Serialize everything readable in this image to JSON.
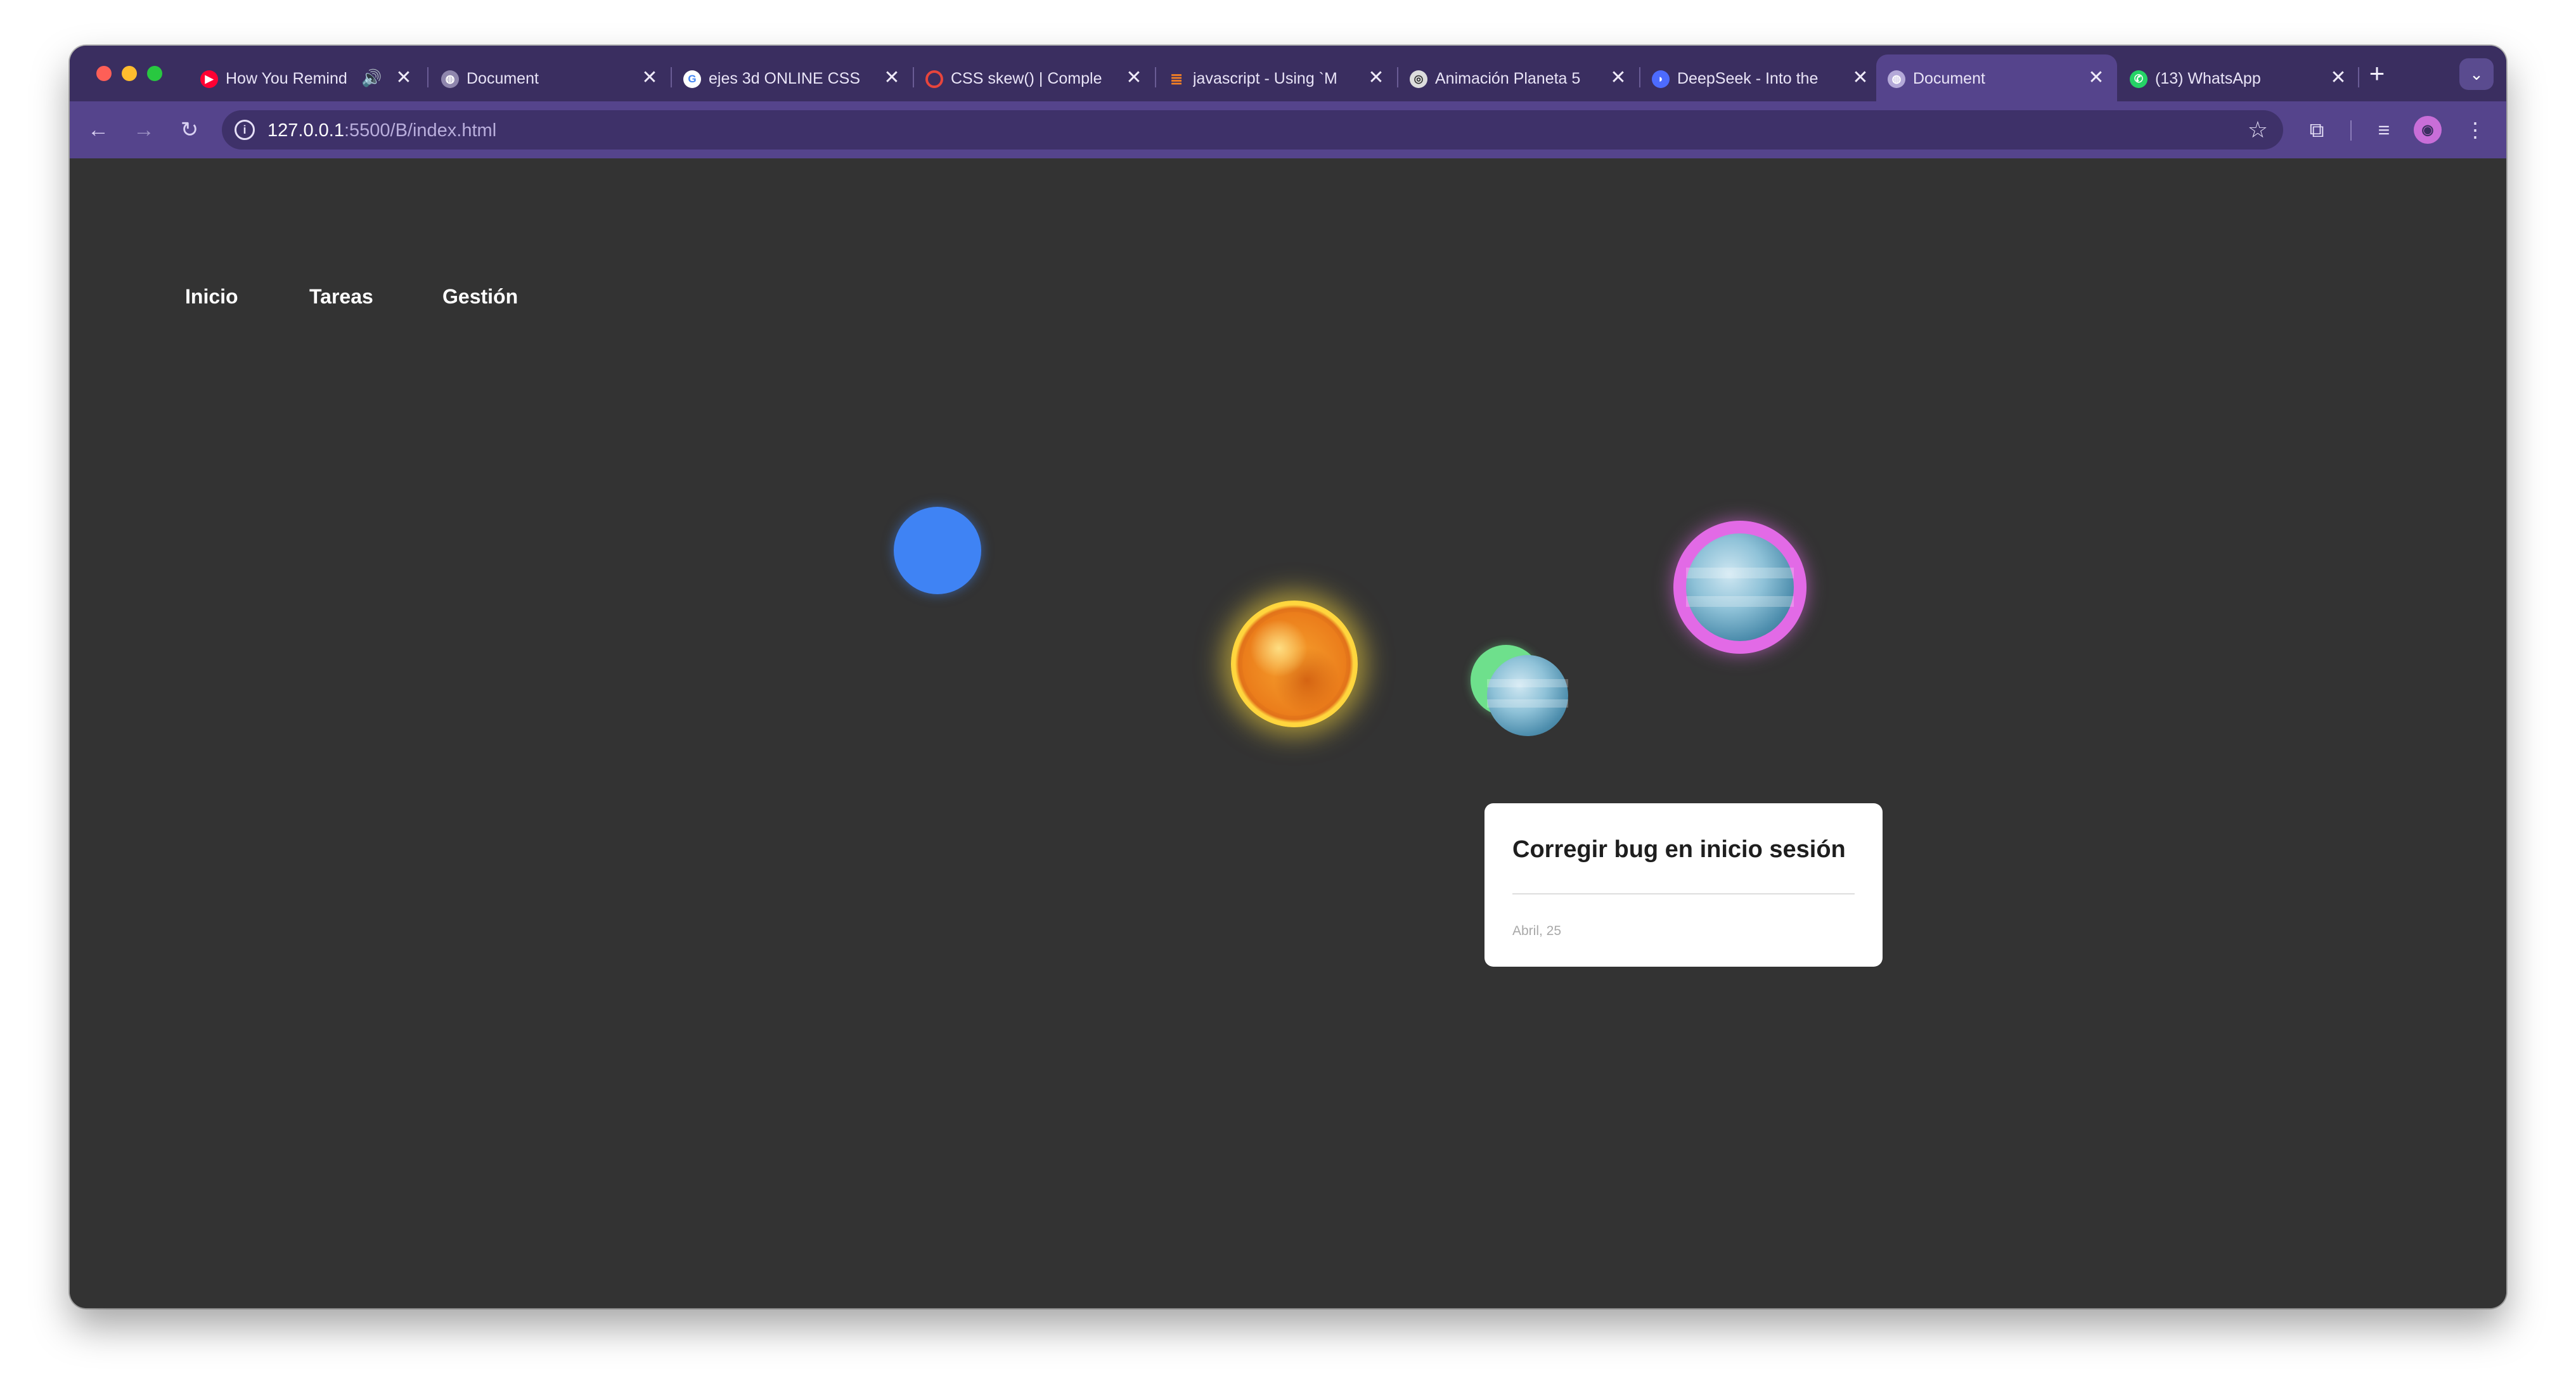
{
  "browser": {
    "tabs": [
      {
        "title": "How You Remind",
        "favicon": "youtube-icon",
        "favicon_color": "#ff0033",
        "audio": true
      },
      {
        "title": "Document",
        "favicon": "globe-icon",
        "favicon_color": "#8f86ad",
        "audio": false
      },
      {
        "title": "ejes 3d ONLINE CSS",
        "favicon": "google-icon",
        "favicon_color": "#ffffff",
        "audio": false
      },
      {
        "title": "CSS skew() | Comple",
        "favicon": "site-icon",
        "favicon_color": "#e8453c",
        "audio": false
      },
      {
        "title": "javascript - Using `M",
        "favicon": "stackoverflow-icon",
        "favicon_color": "#f48024",
        "audio": false
      },
      {
        "title": "Animación Planeta 5",
        "favicon": "codepen-icon",
        "favicon_color": "#dddddd",
        "audio": false
      },
      {
        "title": "DeepSeek - Into the",
        "favicon": "deepseek-icon",
        "favicon_color": "#4d6bfe",
        "audio": false
      },
      {
        "title": "Document",
        "favicon": "globe-icon",
        "favicon_color": "#b4a9d8",
        "audio": false,
        "active": true
      },
      {
        "title": "(13) WhatsApp",
        "favicon": "whatsapp-icon",
        "favicon_color": "#25d366",
        "audio": false
      }
    ],
    "close_glyph": "✕",
    "new_tab_glyph": "+",
    "tab_search_glyph": "⌄",
    "url": {
      "host": "127.0.0.1",
      "path": ":5500/B/index.html"
    },
    "icons": {
      "back": "←",
      "forward": "→",
      "reload": "↻",
      "site_info": "i",
      "bookmark": "☆",
      "extensions": "⧉",
      "media": "≡",
      "profile": "◉",
      "menu": "⋮",
      "audio": "🔊"
    }
  },
  "page": {
    "nav": [
      "Inicio",
      "Tareas",
      "Gestión"
    ],
    "task_card": {
      "title": "Corregir bug en inicio sesión",
      "date": "Abril, 25"
    }
  },
  "colors": {
    "tabstrip": "#3a2e60",
    "toolbar": "#55448c",
    "page_bg": "#333333",
    "blue_planet": "#3f83f4",
    "sun": "#fde441",
    "green_planet": "#6ee08c",
    "ring_planet": "#e26ae6"
  }
}
